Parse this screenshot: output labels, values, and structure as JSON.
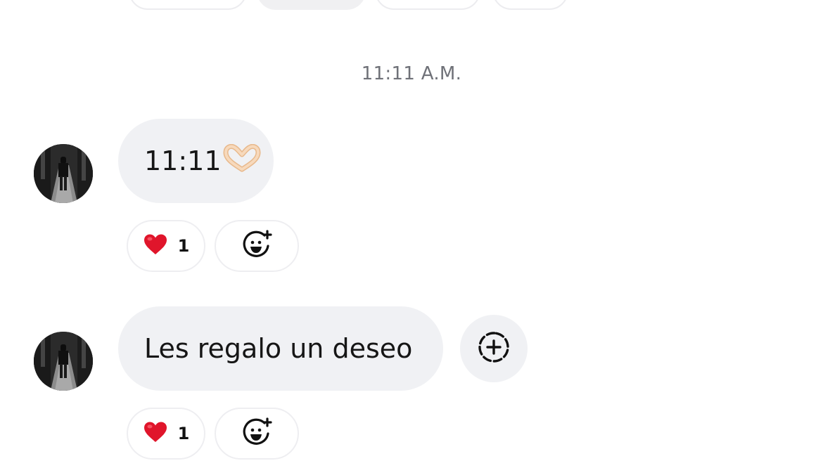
{
  "thread": {
    "timestamp": "11:11 A.M.",
    "messages": [
      {
        "text": "11:11",
        "emoji": "heart-hands",
        "reactions": {
          "emoji": "red-heart",
          "count": "1"
        }
      },
      {
        "text": "Les regalo un deseo",
        "reactions": {
          "emoji": "red-heart",
          "count": "1"
        }
      }
    ]
  },
  "icons": {
    "add_reaction": "smiley-plus-icon",
    "share": "dashed-circle-plus-icon",
    "reaction": "red-heart-icon"
  },
  "colors": {
    "bubble": "#f0f1f4",
    "timestamp": "#6f7178",
    "heart": "#e0152b",
    "pill_border": "#eeeef1"
  }
}
